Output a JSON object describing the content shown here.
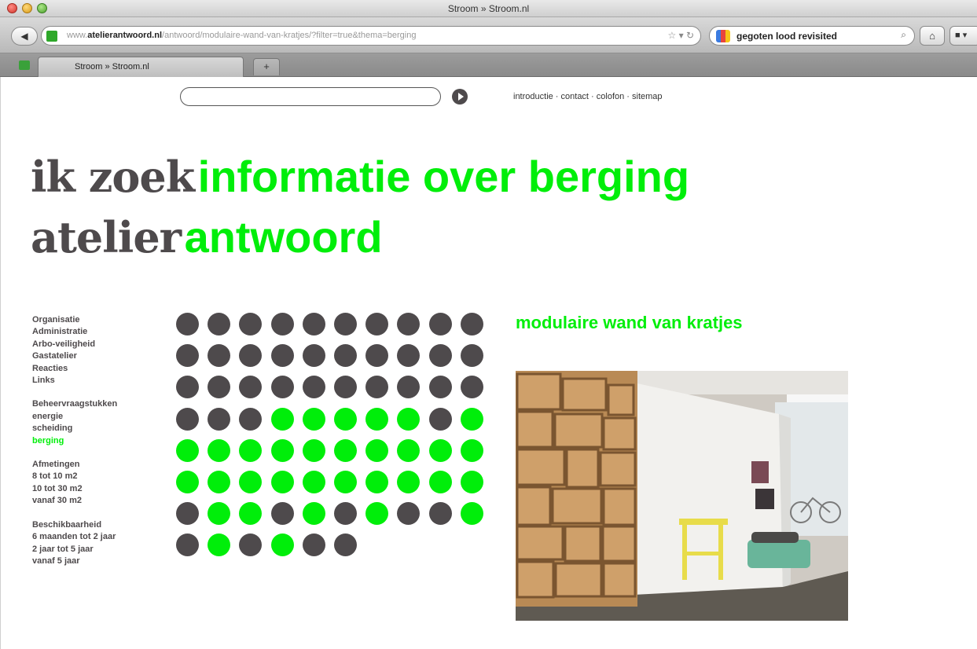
{
  "browser": {
    "window_title": "Stroom » Stroom.nl",
    "url_domain": "www.atelierantwoord.nl",
    "url_path": "/antwoord/modulaire-wand-van-kratjes/?filter=true&thema=berging",
    "url_prefix": "www.",
    "url_host": "atelierantwoord.nl",
    "search_query": "gegoten lood revisited",
    "tab_label": "Stroom » Stroom.nl",
    "new_tab_label": "+"
  },
  "page": {
    "search_placeholder": "",
    "topnav": "introductie · contact · colofon · sitemap",
    "headline": {
      "line1_dark": "ik zoek",
      "line1_green": "informatie over berging",
      "line2_dark": "atelier",
      "line2_green": "antwoord"
    },
    "sidebar": {
      "group1": [
        "Organisatie",
        "Administratie",
        "Arbo-veiligheid",
        "Gastatelier",
        "Reacties",
        "Links"
      ],
      "group2": [
        "Beheervraagstukken",
        "energie",
        "scheiding",
        "berging"
      ],
      "group2_active": "berging",
      "group3": [
        "Afmetingen",
        "8 tot 10 m2",
        "10 tot 30 m2",
        "vanaf 30 m2"
      ],
      "group4": [
        "Beschikbaarheid",
        "6 maanden tot 2 jaar",
        "2 jaar tot 5 jaar",
        "vanaf 5 jaar"
      ]
    },
    "item_title": "modulaire wand van kratjes",
    "dot_grid": [
      "gggggggggg",
      "gggggggggg",
      "gggggggggg",
      "gggGGGGGgG",
      "GGGGGGGGGG",
      "GGGGGGGGGG",
      "gGGgGgGggG",
      "gGgGgg"
    ],
    "colors": {
      "green": "#00ee0a",
      "dark": "#4e4a4c"
    }
  }
}
